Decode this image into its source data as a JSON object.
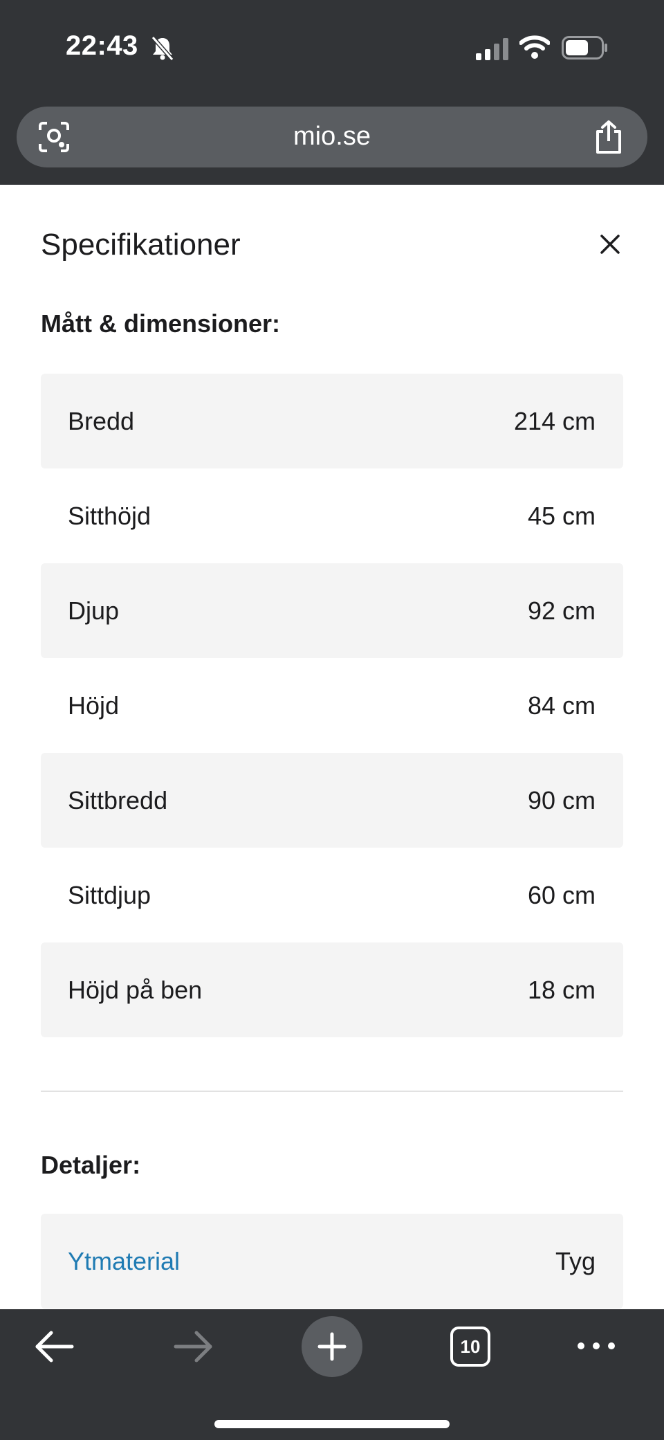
{
  "status_bar": {
    "time": "22:43"
  },
  "browser": {
    "url": "mio.se",
    "tab_count": "10"
  },
  "sheet": {
    "title": "Specifikationer",
    "dimensions_title": "Mått & dimensioner:",
    "dimensions": [
      {
        "label": "Bredd",
        "value": "214 cm"
      },
      {
        "label": "Sitthöjd",
        "value": "45 cm"
      },
      {
        "label": "Djup",
        "value": "92 cm"
      },
      {
        "label": "Höjd",
        "value": "84 cm"
      },
      {
        "label": "Sittbredd",
        "value": "90 cm"
      },
      {
        "label": "Sittdjup",
        "value": "60 cm"
      },
      {
        "label": "Höjd på ben",
        "value": "18 cm"
      }
    ],
    "details_title": "Detaljer:",
    "details": [
      {
        "label": "Ytmaterial",
        "value": "Tyg"
      }
    ]
  },
  "colors": {
    "chrome": "#323437",
    "urlbar": "#5a5d61",
    "row_shade": "#f4f4f4",
    "link": "#1f7bb3"
  },
  "icons": [
    "bell-slash-icon",
    "signal-icon",
    "wifi-icon",
    "battery-icon",
    "lens-icon",
    "share-icon",
    "close-icon",
    "back-arrow-icon",
    "forward-arrow-icon",
    "plus-icon",
    "tabs-icon",
    "more-icon"
  ]
}
